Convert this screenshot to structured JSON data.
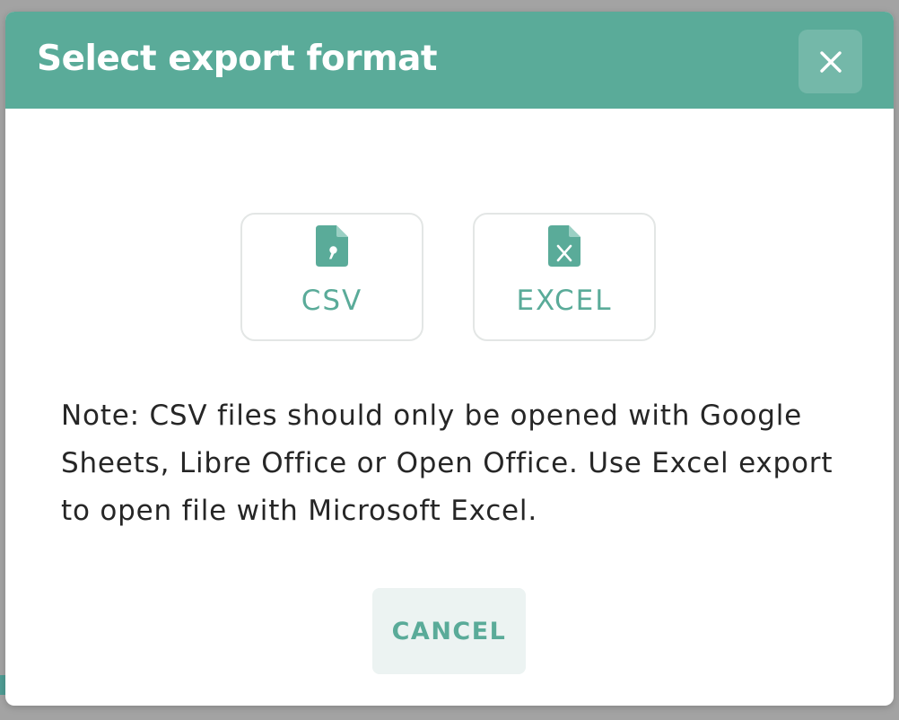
{
  "dialog": {
    "title": "Select export format",
    "close_icon": "close-icon"
  },
  "formats": [
    {
      "label": "CSV",
      "icon": "csv-file-icon"
    },
    {
      "label": "EXCEL",
      "icon": "excel-file-icon"
    }
  ],
  "note": "Note: CSV files should only be opened with Google Sheets, Libre Office or Open Office. Use Excel export to open file with Microsoft Excel.",
  "actions": {
    "cancel_label": "CANCEL"
  },
  "colors": {
    "accent": "#5aab99",
    "cancel_bg": "#ecf3f2",
    "overlay": "#a3a3a3"
  }
}
